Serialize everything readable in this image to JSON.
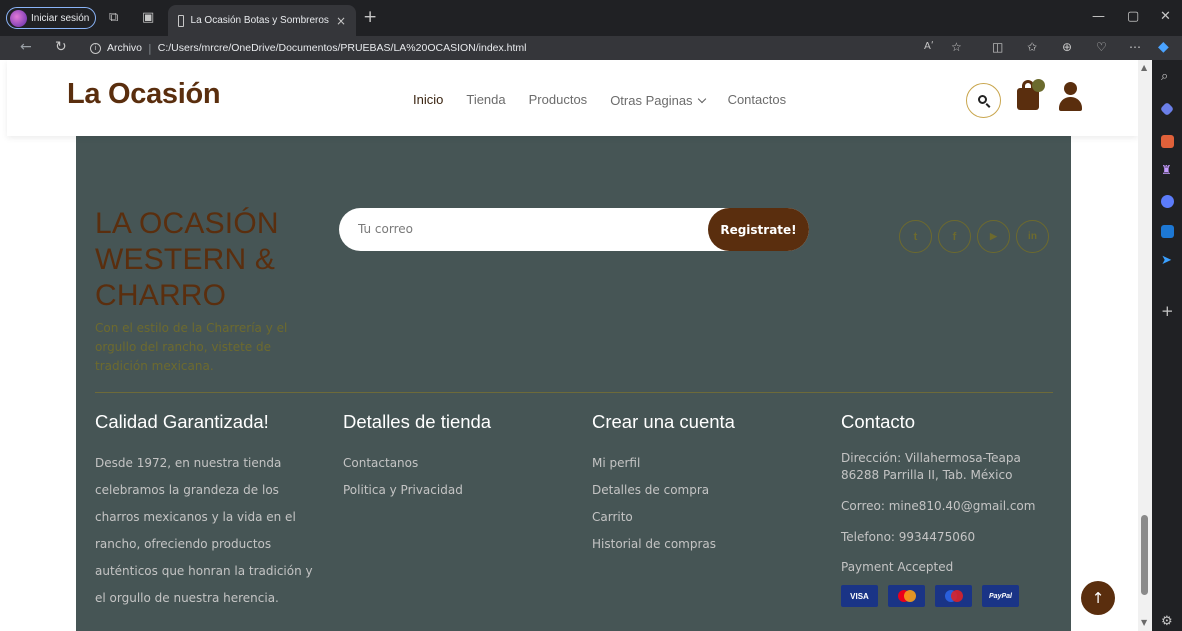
{
  "browser": {
    "profile_label": "Iniciar sesión",
    "tab_title": "La Ocasión Botas y Sombreros",
    "tab_close": "×",
    "new_tab": "+",
    "address_label": "Archivo",
    "address_sep": "|",
    "url": "C:/Users/mrcre/OneDrive/Documentos/PRUEBAS/LA%20OCASION/index.html",
    "read_aloud": "Aʹ"
  },
  "site": {
    "logo": "La Ocasión",
    "nav": [
      {
        "label": "Inicio"
      },
      {
        "label": "Tienda"
      },
      {
        "label": "Productos"
      },
      {
        "label": "Otras Paginas"
      },
      {
        "label": "Contactos"
      }
    ]
  },
  "footer": {
    "brand_title": "LA OCASIÓN WESTERN & CHARRO",
    "brand_tagline": "Con el estilo de la Charrería y el orgullo del rancho, vistete de tradición mexicana.",
    "newsletter": {
      "placeholder": "Tu correo",
      "button": "Registrate!"
    },
    "social": [
      {
        "icon": "twitter-icon",
        "glyph": "t"
      },
      {
        "icon": "facebook-icon",
        "glyph": "f"
      },
      {
        "icon": "youtube-icon",
        "glyph": "▶"
      },
      {
        "icon": "linkedin-icon",
        "glyph": "in"
      }
    ],
    "columns": {
      "quality": {
        "title": "Calidad Garantizada!",
        "text": "Desde 1972, en nuestra tienda celebramos la grandeza de los charros mexicanos y la vida en el rancho, ofreciendo productos auténticos que honran la tradición y el orgullo de nuestra herencia."
      },
      "store": {
        "title": "Detalles de tienda",
        "links": [
          "Contactanos",
          "Politica y Privacidad"
        ]
      },
      "account": {
        "title": "Crear una cuenta",
        "links": [
          "Mi perfil",
          "Detalles de compra",
          "Carrito",
          "Historial de compras"
        ]
      },
      "contact": {
        "title": "Contacto",
        "address": "Dirección: Villahermosa-Teapa 86288 Parrilla II, Tab. México",
        "email": "Correo: mine810.40@gmail.com",
        "phone": "Telefono: 9934475060",
        "payment_label": "Payment Accepted",
        "cards": [
          "VISA",
          "",
          "",
          "PayPal"
        ]
      }
    }
  },
  "colors": {
    "brand_brown": "#5a2e0e",
    "footer_bg": "#465555",
    "accent_olive": "#6d6a2e"
  }
}
